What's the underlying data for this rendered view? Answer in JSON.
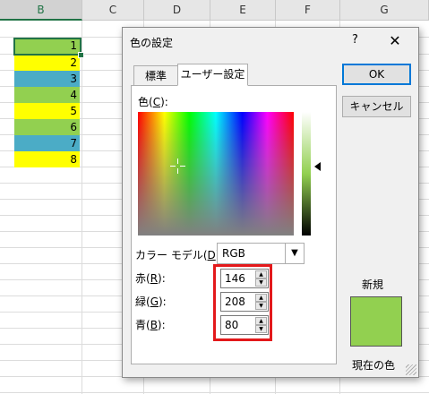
{
  "sheet": {
    "columns": [
      "B",
      "C",
      "D",
      "E",
      "F",
      "G"
    ],
    "rows": [
      {
        "value": "1",
        "color": "#92d050"
      },
      {
        "value": "2",
        "color": "#ffff00"
      },
      {
        "value": "3",
        "color": "#4bacc6"
      },
      {
        "value": "4",
        "color": "#92d050"
      },
      {
        "value": "5",
        "color": "#ffff00"
      },
      {
        "value": "6",
        "color": "#92d050"
      },
      {
        "value": "7",
        "color": "#4bacc6"
      },
      {
        "value": "8",
        "color": "#ffff00"
      }
    ]
  },
  "dialog": {
    "title": "色の設定",
    "help": "?",
    "close": "✕",
    "tabs": {
      "standard": "標準",
      "custom": "ユーザー設定"
    },
    "colors_label": "色(C):",
    "colors_label_main": "色(",
    "colors_label_key": "C",
    "colors_label_tail": "):",
    "model_label_main": "カラー モデル(",
    "model_label_key": "D",
    "model_label_tail": "):",
    "model_value": "RGB",
    "red_label_main": "赤(",
    "red_label_key": "R",
    "red_label_tail": "):",
    "green_label_main": "緑(",
    "green_label_key": "G",
    "green_label_tail": "):",
    "blue_label_main": "青(",
    "blue_label_key": "B",
    "blue_label_tail": "):",
    "red": "146",
    "green": "208",
    "blue": "80",
    "ok": "OK",
    "cancel": "キャンセル",
    "new_label": "新規",
    "current_label": "現在の色",
    "new_color": "#92d050",
    "highlight_color": "#e3191b"
  }
}
